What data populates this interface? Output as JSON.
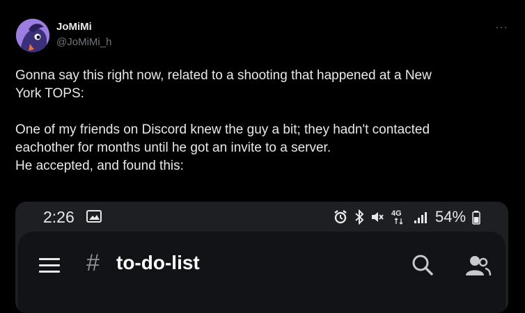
{
  "author": {
    "display_name": "JoMiMi",
    "handle": "@JoMiMi_h",
    "avatar_icon": "pony-avatar"
  },
  "more_label": "···",
  "tweet": {
    "text": "Gonna say this right now, related to a shooting that happened at a New\nYork TOPS:\n\nOne of my friends on Discord knew the guy a bit; they hadn't contacted\neachother for months until he got an invite to a server.\nHe accepted, and found this:"
  },
  "screenshot": {
    "status_bar": {
      "time": "2:26",
      "network": "4G",
      "battery": "54%"
    },
    "app_bar": {
      "hash": "#",
      "channel": "to-do-list"
    }
  },
  "colors": {
    "background": "#000000",
    "text": "#e7e9ea",
    "muted": "#71767b",
    "discord_bg": "#121316",
    "status_bg": "#1e1f23"
  }
}
